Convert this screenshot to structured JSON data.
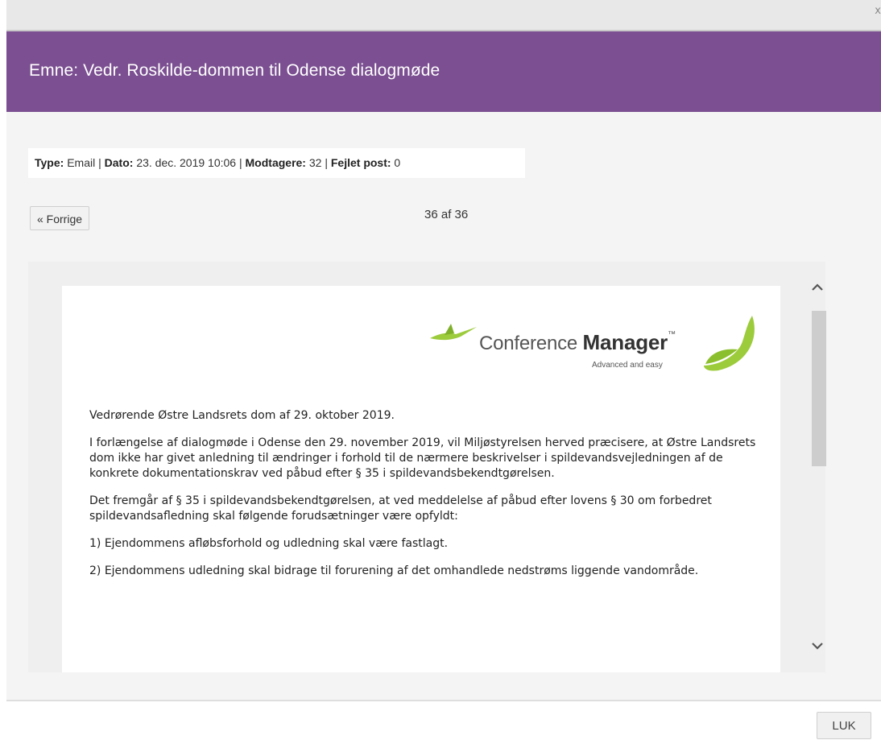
{
  "window": {
    "close_glyph": "x"
  },
  "header": {
    "title": "Emne: Vedr. Roskilde-dommen til Odense dialogmøde"
  },
  "meta": {
    "type_label": "Type:",
    "type_value": "Email",
    "date_label": "Dato:",
    "date_value": "23. dec. 2019 10:06",
    "recipients_label": "Modtagere:",
    "recipients_value": "32",
    "failed_label": "Fejlet post:",
    "failed_value": "0",
    "separator": " | "
  },
  "nav": {
    "prev_label": "« Forrige",
    "pager_text": "36 af 36"
  },
  "logo": {
    "name_light": "Conference ",
    "name_bold": "Manager",
    "tm": "™",
    "tagline": "Advanced and easy",
    "bird_color": "#9ccb3b",
    "swoosh_color": "#9ccb3b"
  },
  "document": {
    "paragraphs": [
      "Vedrørende Østre Landsrets dom af 29. oktober 2019.",
      "I forlængelse af dialogmøde i Odense den 29. november 2019, vil Miljøstyrelsen herved præcisere, at Østre Landsrets dom ikke har givet anledning til ændringer i forhold til de nærmere beskrivelser i spildevandsvejledningen af de konkrete dokumentationskrav ved påbud efter § 35 i spildevandsbekendtgørelsen.",
      "Det fremgår af § 35 i spildevandsbekendtgørelsen, at ved meddelelse af påbud efter lovens § 30 om forbedret spildevandsafledning skal følgende forudsætninger være opfyldt:",
      "1) Ejendommens afløbsforhold og udledning skal være fastlagt.",
      "2) Ejendommens udledning skal bidrage til forurening af det omhandlede nedstrøms liggende vandområde."
    ]
  },
  "scroll": {
    "up_icon": "chevron-up-icon",
    "down_icon": "chevron-down-icon"
  },
  "footer": {
    "close_label": "LUK"
  },
  "colors": {
    "header_bg": "#7b4f91",
    "header_text": "#ffffff"
  }
}
